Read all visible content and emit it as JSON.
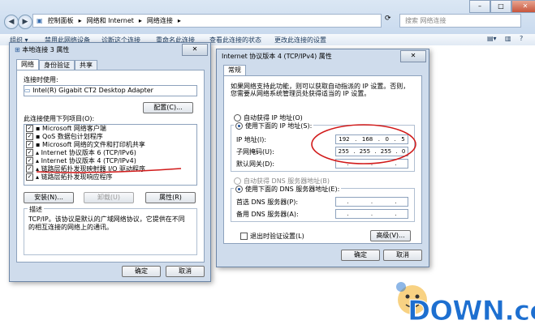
{
  "explorer": {
    "breadcrumb": [
      "控制面板",
      "网络和 Internet",
      "网络连接"
    ],
    "search_placeholder": "搜索 网络连接",
    "commands": [
      "组织 ▾",
      "禁用此网络设备",
      "诊断这个连接",
      "重命名此连接",
      "查看此连接的状态",
      "更改此连接的设置"
    ]
  },
  "props_dialog": {
    "title": "本地连接 3 属性",
    "tabs": [
      "网络",
      "身份验证",
      "共享"
    ],
    "connect_using_label": "连接时使用:",
    "adapter": "Intel(R) Gigabit CT2 Desktop Adapter",
    "configure_button": "配置(C)...",
    "items_label": "此连接使用下列项目(O):",
    "items": [
      {
        "label": "Microsoft 网络客户端",
        "checked": true
      },
      {
        "label": "QoS 数据包计划程序",
        "checked": true
      },
      {
        "label": "Microsoft 网络的文件和打印机共享",
        "checked": true
      },
      {
        "label": "Internet 协议版本 6 (TCP/IPv6)",
        "checked": true
      },
      {
        "label": "Internet 协议版本 4 (TCP/IPv4)",
        "checked": true
      },
      {
        "label": "链路层拓扑发现映射器 I/O 驱动程序",
        "checked": true
      },
      {
        "label": "链路层拓扑发现响应程序",
        "checked": true
      }
    ],
    "install_button": "安装(N)...",
    "uninstall_button": "卸载(U)",
    "properties_button": "属性(R)",
    "description_label": "描述",
    "description_text": "TCP/IP。该协议是默认的广域网络协议，它提供在不同的相互连接的网络上的通讯。",
    "ok_button": "确定",
    "cancel_button": "取消"
  },
  "ipv4_dialog": {
    "title": "Internet 协议版本 4 (TCP/IPv4) 属性",
    "tab": "常规",
    "intro": "如果网络支持此功能，则可以获取自动指派的 IP 设置。否则，您需要从网络系统管理员处获得适当的 IP 设置。",
    "auto_ip": "自动获得 IP 地址(O)",
    "manual_ip": "使用下面的 IP 地址(S):",
    "ip_label": "IP 地址(I):",
    "ip_value": [
      "192",
      "168",
      "0",
      "5"
    ],
    "mask_label": "子网掩码(U):",
    "mask_value": [
      "255",
      "255",
      "255",
      "0"
    ],
    "gateway_label": "默认网关(D):",
    "auto_dns": "自动获得 DNS 服务器地址(B)",
    "manual_dns": "使用下面的 DNS 服务器地址(E):",
    "dns1_label": "首选 DNS 服务器(P):",
    "dns2_label": "备用 DNS 服务器(A):",
    "validate_label": "退出时验证设置(L)",
    "advanced_button": "高级(V)...",
    "ok_button": "确定",
    "cancel_button": "取消"
  },
  "watermark": {
    "text": "DOWN.cc"
  },
  "colors": {
    "annotation_red": "#d11a1a",
    "watermark_blue": "#1d6fd0",
    "watermark_orange": "#f39a1e"
  }
}
